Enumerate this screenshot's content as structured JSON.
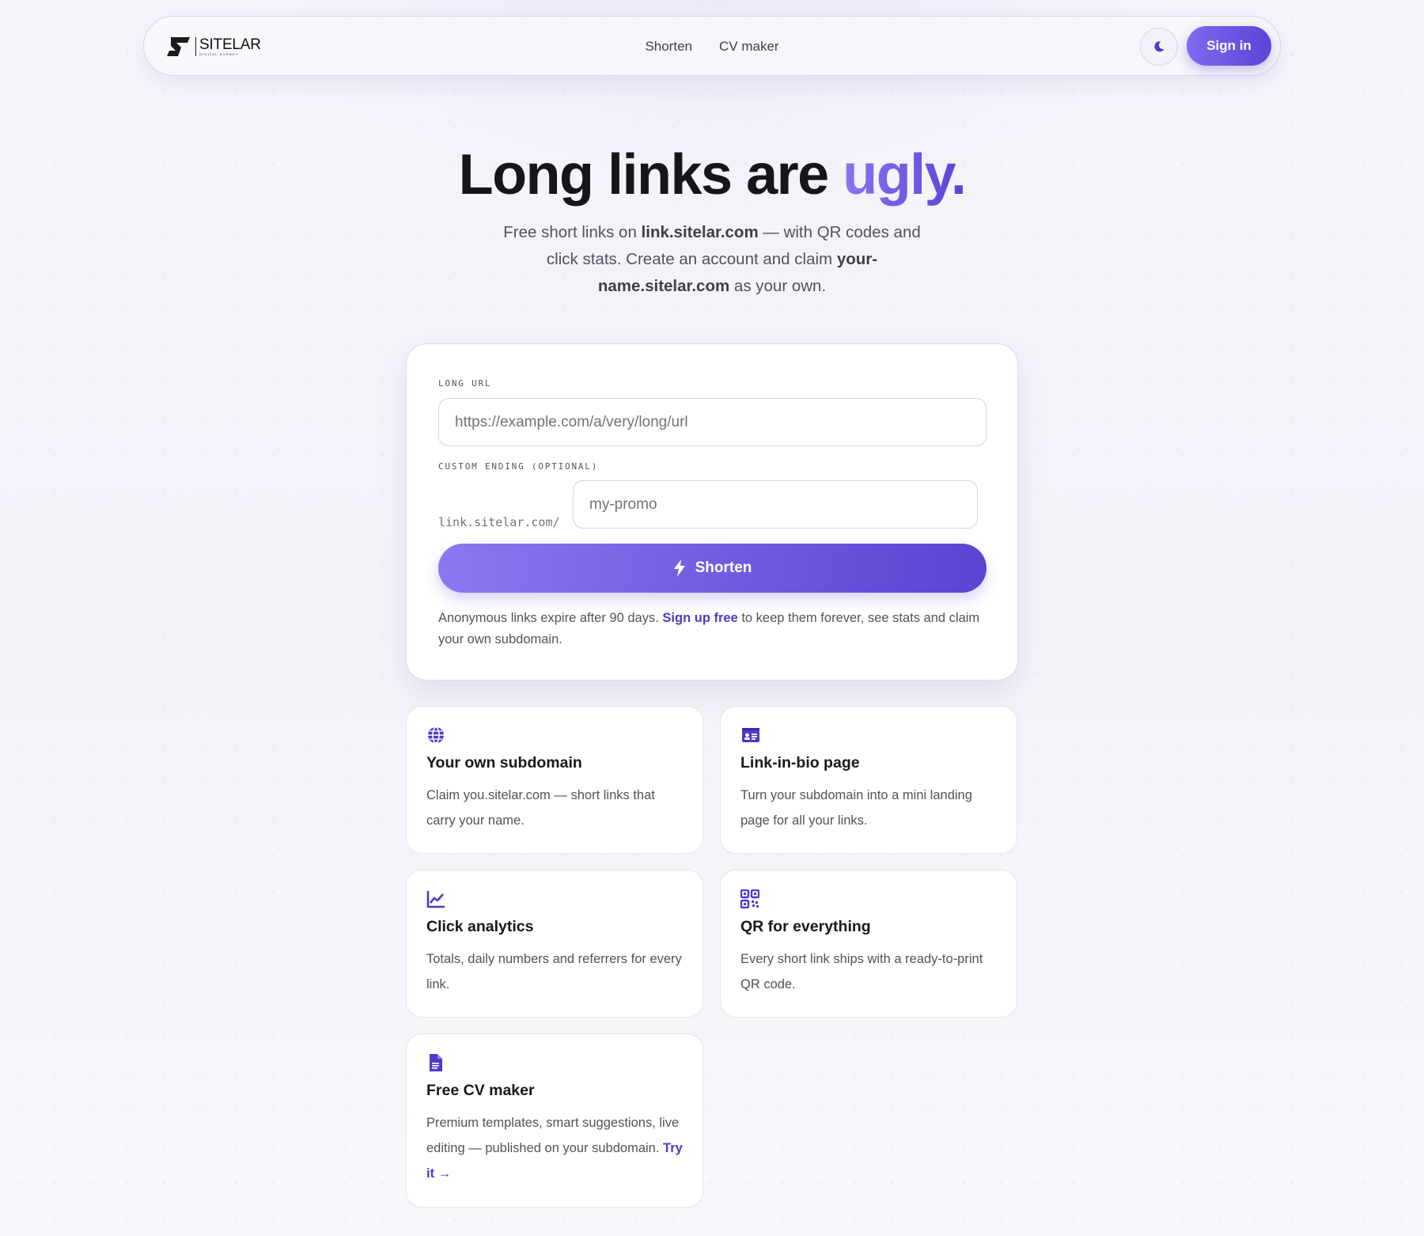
{
  "brand": {
    "logo_text": "SITELAR",
    "logo_subtext": "Digital Agency"
  },
  "nav": {
    "links": [
      "Shorten",
      "CV maker"
    ],
    "signin_label": "Sign in"
  },
  "hero": {
    "title_main": "Long links are ",
    "title_accent": "ugly.",
    "sub_1": "Free short links on ",
    "sub_domain": "link.sitelar.com",
    "sub_2": " — with QR codes and click stats. Create an account and claim ",
    "sub_claim": "your-name.sitelar.com",
    "sub_3": " as your own."
  },
  "form": {
    "long_url_label": "LONG URL",
    "long_url_placeholder": "https://example.com/a/very/long/url",
    "custom_label": "CUSTOM ENDING (OPTIONAL)",
    "prefix": "link.sitelar.com/",
    "custom_placeholder": "my-promo",
    "submit_label": "Shorten",
    "note_1": "Anonymous links expire after 90 days. ",
    "note_link": "Sign up free",
    "note_2": " to keep them forever, see stats and claim your own subdomain."
  },
  "features": [
    {
      "icon": "globe-icon",
      "title": "Your own subdomain",
      "desc": "Claim you.sitelar.com — short links that carry your name."
    },
    {
      "icon": "id-card-icon",
      "title": "Link-in-bio page",
      "desc": "Turn your subdomain into a mini landing page for all your links."
    },
    {
      "icon": "chart-line-icon",
      "title": "Click analytics",
      "desc": "Totals, daily numbers and referrers for every link."
    },
    {
      "icon": "qr-code-icon",
      "title": "QR for everything",
      "desc": "Every short link ships with a ready-to-print QR code."
    },
    {
      "icon": "document-icon",
      "title": "Free CV maker",
      "desc": "Premium templates, smart suggestions, live editing — published on your subdomain. ",
      "link": "Try it →"
    }
  ],
  "colors": {
    "accent": "#5b44d6",
    "accent_light": "#8a74f2",
    "text": "#18181b",
    "muted": "#52525b"
  }
}
